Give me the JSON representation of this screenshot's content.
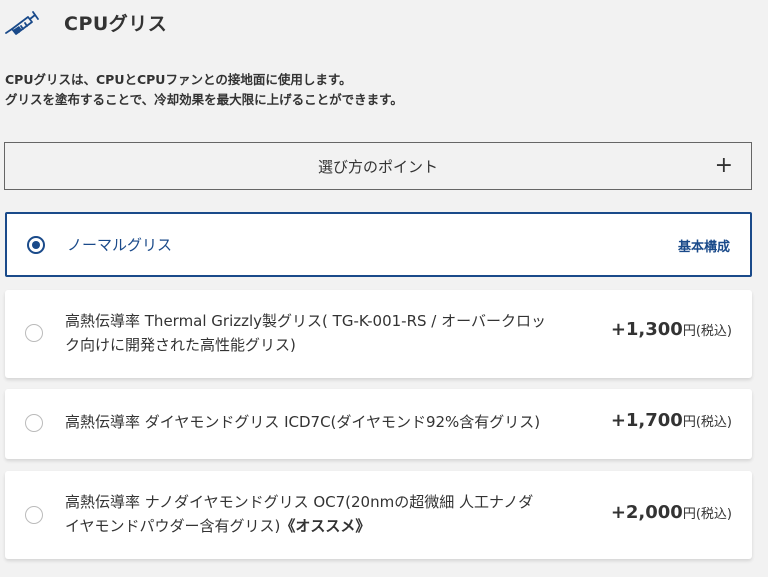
{
  "header": {
    "title": "CPUグリス",
    "icon": "syringe-icon"
  },
  "description": {
    "line1": "CPUグリスは、CPUとCPUファンとの接地面に使用します。",
    "line2": "グリスを塗布することで、冷却効果を最大限に上げることができます。"
  },
  "points": {
    "label": "選び方のポイント",
    "toggle": "+"
  },
  "options": [
    {
      "line1": "ノーマルグリス",
      "badge": "基本構成",
      "selected": true
    },
    {
      "line1": "高熱伝導率 Thermal Grizzly製グリス( TG-K-001-RS / オーバークロッ",
      "line2": "ク向けに開発された高性能グリス)",
      "price": "+1,300",
      "unit": "円(税込)",
      "selected": false
    },
    {
      "line1": "高熱伝導率 ダイヤモンドグリス ICD7C(ダイヤモンド92%含有グリス)",
      "price": "+1,700",
      "unit": "円(税込)",
      "selected": false
    },
    {
      "line1": "高熱伝導率 ナノダイヤモンドグリス OC7(20nmの超微細 人工ナノダ",
      "line2": "イヤモンドパウダー含有グリス)",
      "recommend": "《オススメ》",
      "price": "+2,000",
      "unit": "円(税込)",
      "selected": false
    }
  ],
  "colors": {
    "accent": "#1a4a8a",
    "background": "#f2f2f2"
  }
}
